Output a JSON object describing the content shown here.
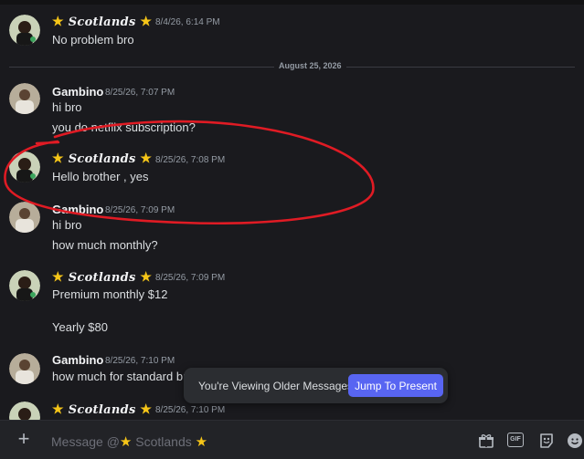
{
  "colors": {
    "accent": "#5865f2",
    "star": "#f5c518",
    "annotation": "#e01b24",
    "background": "#1a1a1e"
  },
  "date_divider": "August 25, 2026",
  "messages": [
    {
      "user": "Scotlands",
      "star_name": true,
      "time": "8/4/26, 6:14 PM",
      "lines": [
        "No problem bro"
      ],
      "avatar": "scotlands-avatar"
    },
    {
      "user": "Gambino",
      "star_name": false,
      "time": "8/25/26, 7:07 PM",
      "lines": [
        "hi bro",
        "you do netflix subscription?"
      ],
      "avatar": "gambino-avatar"
    },
    {
      "user": "Scotlands",
      "star_name": true,
      "time": "8/25/26, 7:08 PM",
      "lines": [
        "Hello brother , yes"
      ],
      "avatar": "scotlands-avatar"
    },
    {
      "user": "Gambino",
      "star_name": false,
      "time": "8/25/26, 7:09 PM",
      "lines": [
        "hi bro",
        "how much monthly?"
      ],
      "avatar": "gambino-avatar"
    },
    {
      "user": "Scotlands",
      "star_name": true,
      "time": "8/25/26, 7:09 PM",
      "lines": [
        "Premium monthly $12",
        "Yearly $80"
      ],
      "avatar": "scotlands-avatar"
    },
    {
      "user": "Gambino",
      "star_name": false,
      "time": "8/25/26, 7:10 PM",
      "lines": [
        "how much for standard br"
      ],
      "avatar": "gambino-avatar"
    },
    {
      "user": "Scotlands",
      "star_name": true,
      "time": "8/25/26, 7:10 PM",
      "lines": [],
      "avatar": "scotlands-avatar"
    }
  ],
  "older_messages": {
    "text": "You're Viewing Older Messages",
    "button": "Jump To Present"
  },
  "composer": {
    "placeholder_prefix": "Message @",
    "placeholder_name": "Scotlands",
    "icons": [
      "gift-icon",
      "gif-icon",
      "sticker-icon",
      "emoji-icon"
    ],
    "gif_label": "GIF"
  }
}
